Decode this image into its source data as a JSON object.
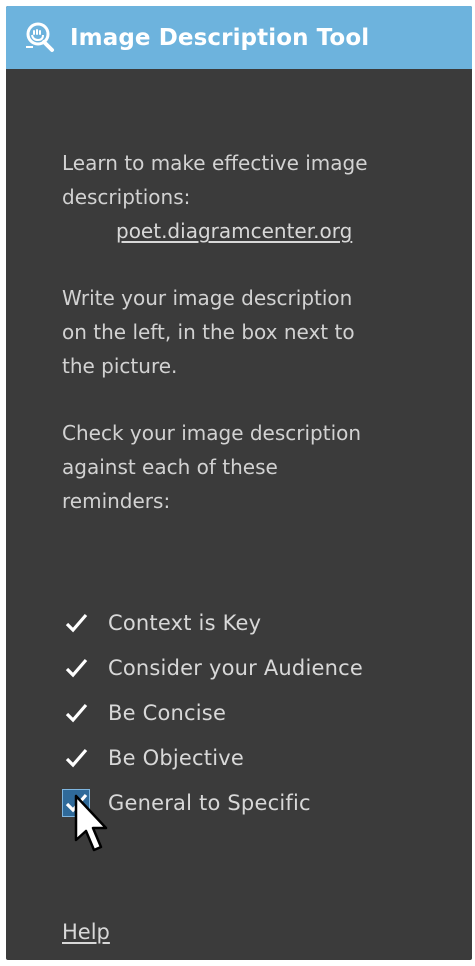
{
  "panel": {
    "title": "Image Description Tool",
    "title_icon": "magnifier-hand-icon",
    "header_color": "#6db3dd",
    "background_color": "#3b3b3b"
  },
  "intro": {
    "learn_text_line1": "Learn to make effective image",
    "learn_text_line2": "descriptions:",
    "link_text": "poet.diagramcenter.org",
    "write_line1": "Write your image description",
    "write_line2": "on the left, in the box next to",
    "write_line3": "the picture.",
    "check_line1": "Check your image description",
    "check_line2": "against each of these",
    "check_line3": "reminders:"
  },
  "reminders": [
    {
      "label": "Context is Key",
      "checked": true
    },
    {
      "label": "Consider your Audience",
      "checked": true
    },
    {
      "label": "Be Concise",
      "checked": true
    },
    {
      "label": "Be Objective",
      "checked": true
    },
    {
      "label": "General to Specific",
      "checked": true
    }
  ],
  "footer": {
    "help_label": "Help"
  }
}
